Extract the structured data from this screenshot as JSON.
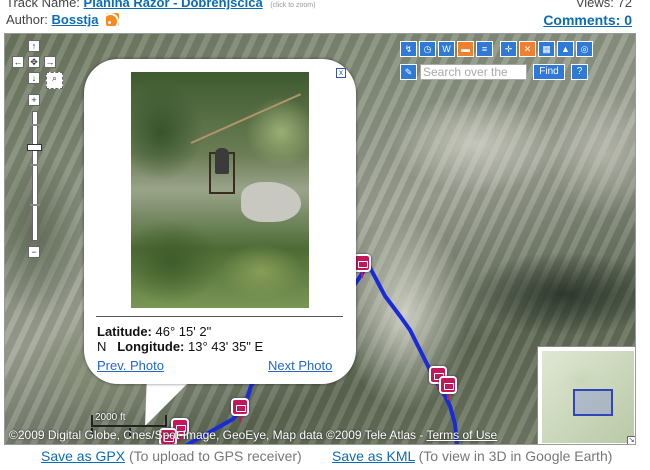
{
  "header": {
    "track_label": "Track Name:",
    "track_name": "Planina Razor - Dobrenjscica",
    "click_to_zoom": "(click to zoom)",
    "views_label": "Views: 72",
    "author_label": "Author:",
    "author_name": "Bosstja",
    "comments_link": "Comments: 0"
  },
  "toolbar": {
    "search_placeholder": "Search over the",
    "find_label": "Find",
    "help_label": "?"
  },
  "popup": {
    "lat_label": "Latitude:",
    "lat_value": "46° 15' 2\"",
    "lat_dir": "N",
    "lng_label": "Longitude:",
    "lng_value": "13° 43' 35\" E",
    "prev_label": "Prev. Photo",
    "next_label": "Next Photo",
    "close_label": "x"
  },
  "map": {
    "scale_label": "2000 ft",
    "copyright": "©2009 Digital Globe, Cnes/Spot Image, GeoEye, Map data ©2009 Tele Atlas -",
    "terms_link": "Terms of Use",
    "track_color": "#1a2ad8",
    "marker_color": "#c2185b"
  },
  "footer": {
    "gpx_link": "Save as GPX",
    "gpx_note": "(To upload to GPS receiver)",
    "kml_link": "Save as KML",
    "kml_note": "(To view in 3D in Google Earth)"
  }
}
